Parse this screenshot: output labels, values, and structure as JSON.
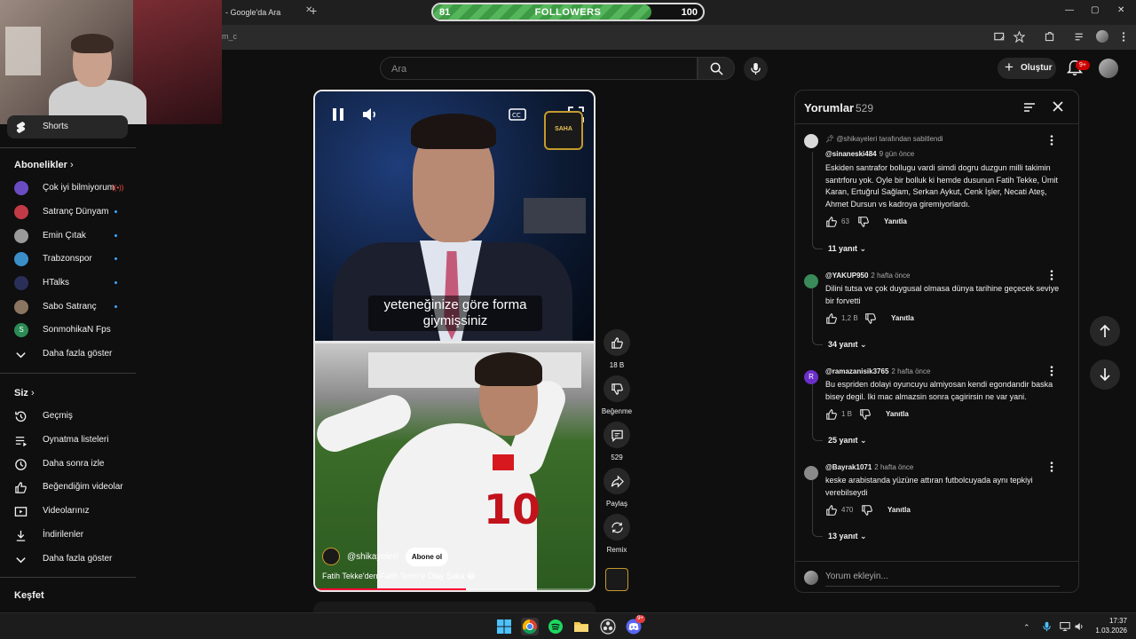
{
  "browser": {
    "tab_title": "- Google'da Ara",
    "tab_close": "✕",
    "new_tab": "+",
    "address_fragment": "m_c",
    "window_controls": [
      "—",
      "▢",
      "✕"
    ]
  },
  "followers_widget": {
    "label": "FOLLOWERS",
    "current": "81",
    "goal": "100",
    "progress_fraction": 0.81,
    "accent_color": "#4fae55"
  },
  "header": {
    "search_placeholder": "Ara",
    "create_label": "Oluştur",
    "notification_badge": "9+"
  },
  "sidebar": {
    "shorts_label": "Shorts",
    "subscriptions_heading": "Abonelikler",
    "subscriptions": [
      {
        "label": "Çok iyi bilmiyorum",
        "status": "live",
        "avatar_color": "#6a4cc2"
      },
      {
        "label": "Satranç Dünyam",
        "status": "dot",
        "avatar_color": "#c23a46"
      },
      {
        "label": "Emin Çıtak",
        "status": "dot",
        "avatar_color": "#9a9a9a"
      },
      {
        "label": "Trabzonspor",
        "status": "dot",
        "avatar_color": "#3b8fc9"
      },
      {
        "label": "HTalks",
        "status": "dot",
        "avatar_color": "#2a2f5a"
      },
      {
        "label": "Sabo Satranç",
        "status": "dot",
        "avatar_color": "#8a7560"
      },
      {
        "label": "SonmohikaN Fps",
        "status": "none",
        "avatar_color": "#2c8a55",
        "initial": "S"
      }
    ],
    "subscriptions_more": "Daha fazla göster",
    "you_heading": "Siz",
    "you_items": [
      {
        "label": "Geçmiş",
        "icon": "history-icon"
      },
      {
        "label": "Oynatma listeleri",
        "icon": "playlists-icon"
      },
      {
        "label": "Daha sonra izle",
        "icon": "watch-later-icon"
      },
      {
        "label": "Beğendiğim videolar",
        "icon": "thumbs-up-icon"
      },
      {
        "label": "Videolarınız",
        "icon": "your-videos-icon"
      },
      {
        "label": "İndirilenler",
        "icon": "download-icon"
      }
    ],
    "you_more": "Daha fazla göster",
    "explore_heading": "Keşfet"
  },
  "video": {
    "subtitle": "yeteneğinize göre forma giymişsiniz",
    "logo_text": "SAHA",
    "channel_name": "@shikayeleri",
    "subscribe_label": "Abone ol",
    "title": "Fatih Tekke'den Fatih Terim'e Olay Şaka 😂",
    "jersey_number": "10",
    "progress_fraction": 0.54,
    "accent_color": "#ff0033"
  },
  "actions": {
    "like_count": "18 B",
    "dislike_label": "Beğenme",
    "comment_count": "529",
    "share_label": "Paylaş",
    "remix_label": "Remix"
  },
  "comments": {
    "title": "Yorumlar",
    "count": "529",
    "reply_label": "Yanıtla",
    "input_placeholder": "Yorum ekleyin...",
    "items": [
      {
        "pinned_text": "@shikayeleri tarafından sabitlendi",
        "author": "@sinaneski484",
        "time": "9 gün önce",
        "text": "Eskiden santrafor bollugu vardi simdi dogru duzgun milli takimin santrforu yok. Oyle bir bolluk ki hemde dusunun Fatih Tekke, Ümit Karan, Ertuğrul Sağlam, Serkan Aykut, Cenk İşler, Necati Ateş, Ahmet Dursun vs kadroya giremiyorlardı.",
        "likes": "63",
        "replies": "11 yanıt",
        "avatar_color": "#d9d9d9"
      },
      {
        "pinned_text": "",
        "author": "@YAKUP950",
        "time": "2 hafta önce",
        "text": "Dilini tutsa ve çok duygusal olmasa dünya tarihine geçecek seviye bir forvetti",
        "likes": "1,2 B",
        "replies": "34 yanıt",
        "avatar_color": "#3a8a5a"
      },
      {
        "pinned_text": "",
        "author": "@ramazanisik3765",
        "time": "2 hafta önce",
        "text": "Bu espriden dolayi oyuncuyu almiyosan kendi egondandir baska bisey degil. Iki mac almazsin sonra çagirirsin ne var yani.",
        "likes": "1 B",
        "replies": "25 yanıt",
        "avatar_color": "#6b2fc9",
        "initial": "R"
      },
      {
        "pinned_text": "",
        "author": "@Bayrak1071",
        "time": "2 hafta önce",
        "text": "keske arabistanda yüzüne attıran futbolcuyada aynı tepkiyi verebilseydi",
        "likes": "470",
        "replies": "13 yanıt",
        "avatar_color": "#8a8a8a"
      }
    ]
  },
  "taskbar": {
    "time": "17:37",
    "date": "1.03.2026",
    "discord_badge": "9+"
  }
}
